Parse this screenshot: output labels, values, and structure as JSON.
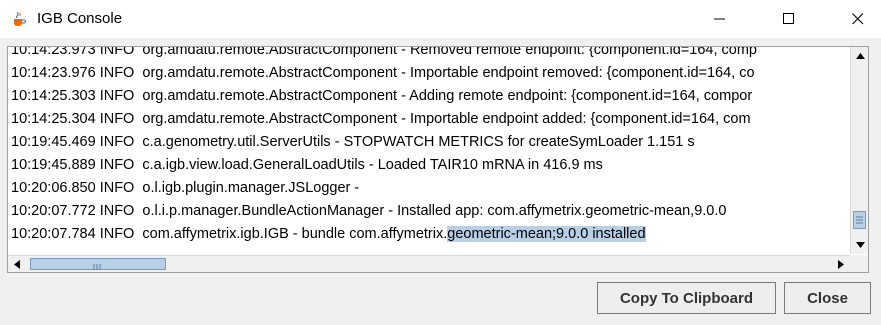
{
  "window": {
    "title": "IGB Console",
    "icons": {
      "app": "java-cup-icon",
      "minimize": "minimize-icon",
      "maximize": "maximize-icon",
      "close": "close-icon"
    }
  },
  "log": {
    "lines": [
      "10:14:23.973 INFO  org.amdatu.remote.AbstractComponent - Removed remote endpoint: {component.id=164, comp",
      "10:14:23.976 INFO  org.amdatu.remote.AbstractComponent - Importable endpoint removed: {component.id=164, co",
      "10:14:25.303 INFO  org.amdatu.remote.AbstractComponent - Adding remote endpoint: {component.id=164, compor",
      "10:14:25.304 INFO  org.amdatu.remote.AbstractComponent - Importable endpoint added: {component.id=164, com",
      "10:19:45.469 INFO  c.a.genometry.util.ServerUtils - STOPWATCH METRICS for createSymLoader 1.151 s",
      "10:19:45.889 INFO  c.a.igb.view.load.GeneralLoadUtils - Loaded TAIR10 mRNA in 416.9 ms",
      "10:20:06.850 INFO  o.l.igb.plugin.manager.JSLogger -",
      "10:20:07.772 INFO  o.l.i.p.manager.BundleActionManager - Installed app: com.affymetrix.geometric-mean,9.0.0"
    ],
    "last_line": {
      "prefix": "10:20:07.784 INFO  com.affymetrix.igb.IGB - bundle com.affymetrix.",
      "selected": "geometric-mean;9.0.0 installed"
    }
  },
  "buttons": {
    "copy_label": "Copy To Clipboard",
    "close_label": "Close"
  },
  "colors": {
    "selection": "#b8cfe5",
    "window_bg": "#f0f0f0"
  }
}
